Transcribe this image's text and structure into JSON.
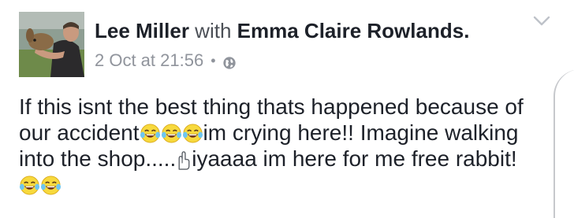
{
  "post": {
    "author": "Lee Miller",
    "with_text": "with",
    "tagged": "Emma Claire Rowlands.",
    "date": "2 Oct at 21:56",
    "separator": "•",
    "privacy_icon": "globe-icon",
    "menu_icon": "chevron-down-icon",
    "lines": {
      "l1": "If this isnt the best thing thats happened because of",
      "l2a": "our accident",
      "l2b": "im crying here!! Imagine walking",
      "l3a": "into the shop.....",
      "l3b": "iyaaaa im here for me free rabbit!"
    },
    "emoji_icon": "tears-of-joy-emoji-icon",
    "gesture_icon": "raised-fingers-icon"
  }
}
